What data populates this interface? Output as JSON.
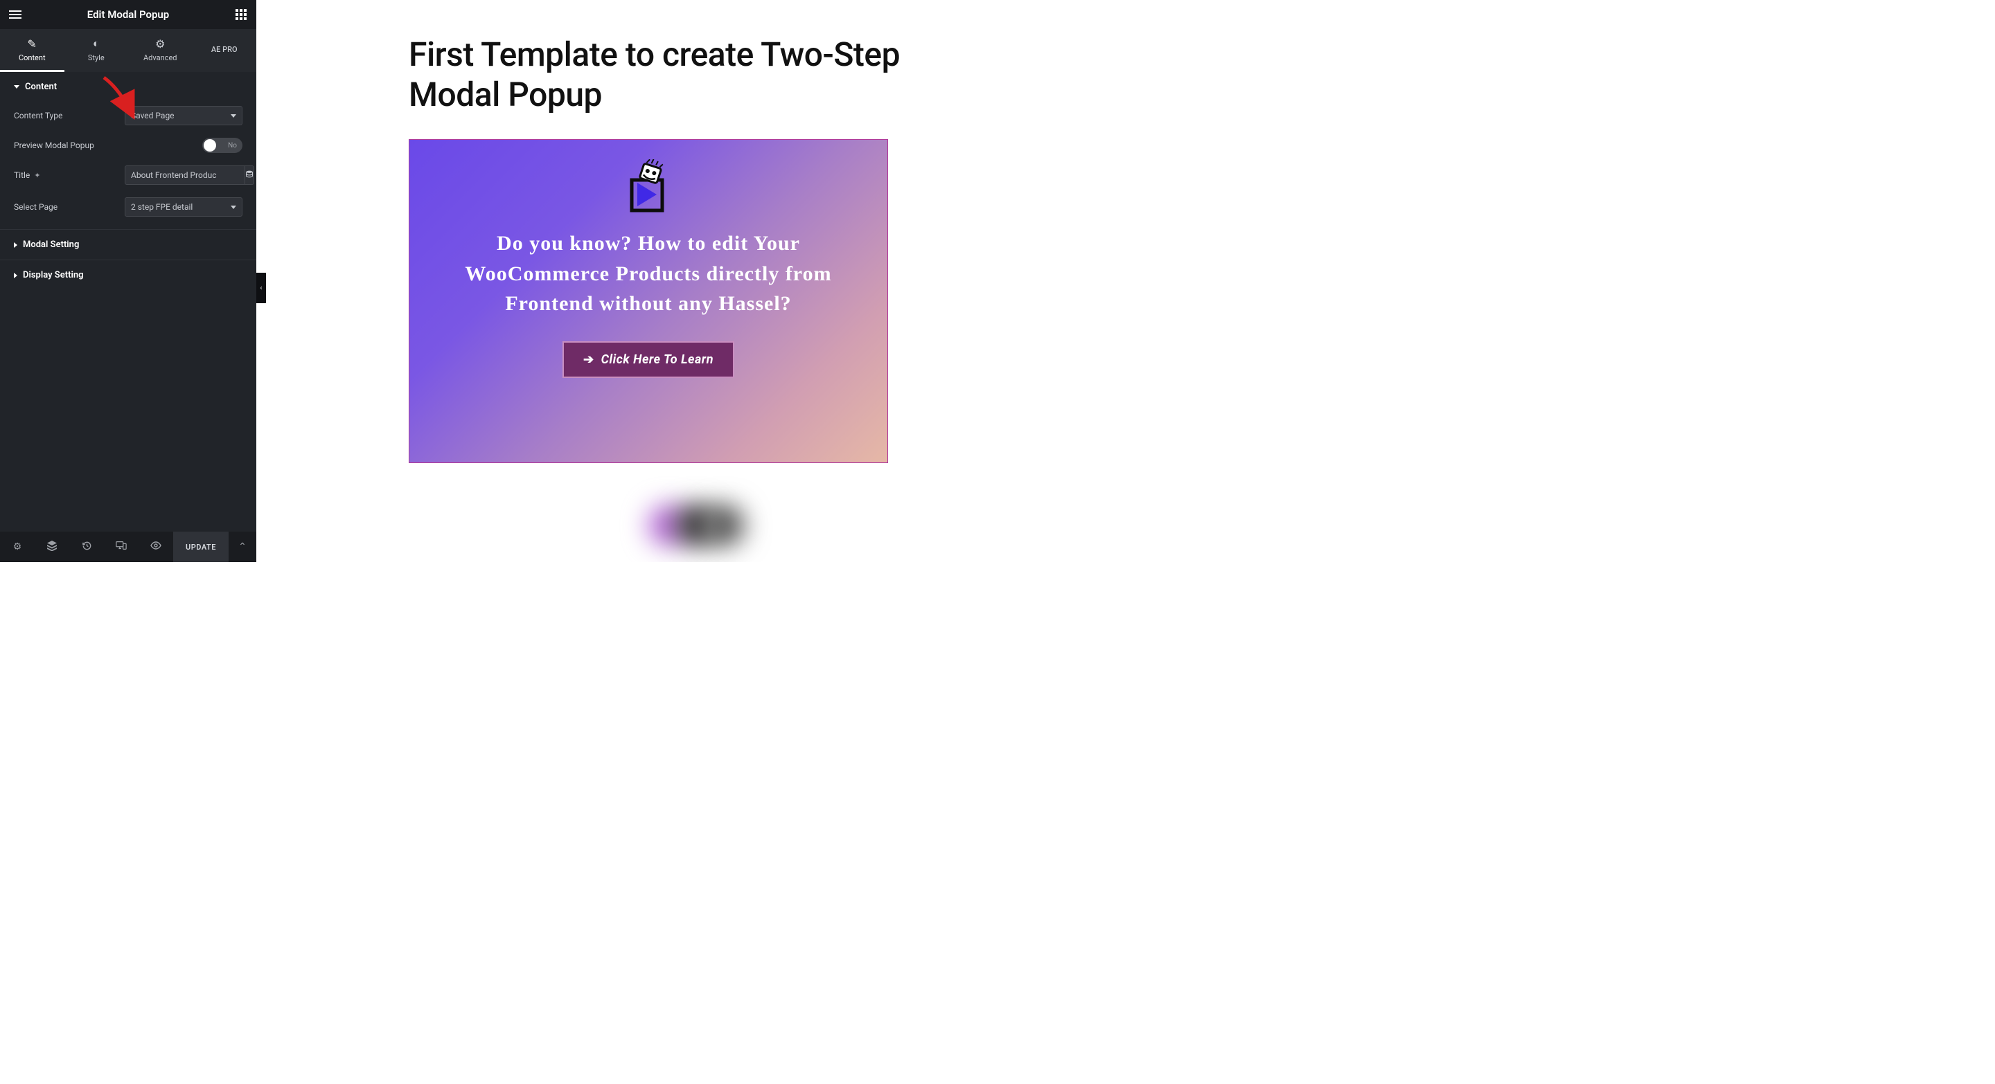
{
  "header": {
    "title": "Edit Modal Popup"
  },
  "tabs": {
    "content": "Content",
    "style": "Style",
    "advanced": "Advanced",
    "aepro": "AE PRO"
  },
  "sections": {
    "content": {
      "title": "Content",
      "content_type_label": "Content Type",
      "content_type_value": "Saved Page",
      "preview_label": "Preview Modal Popup",
      "preview_toggle": "No",
      "title_label": "Title",
      "title_value": "About Frontend Produc",
      "select_page_label": "Select Page",
      "select_page_value": "2 step FPE detail"
    },
    "modal_setting": "Modal Setting",
    "display_setting": "Display Setting"
  },
  "footer": {
    "update": "UPDATE"
  },
  "preview": {
    "heading": "First Template to create Two-Step Modal Popup",
    "card_headline": "Do you know? How to edit Your WooCommerce Products directly from Frontend without any Hassel?",
    "cta_label": "Click Here To Learn"
  }
}
